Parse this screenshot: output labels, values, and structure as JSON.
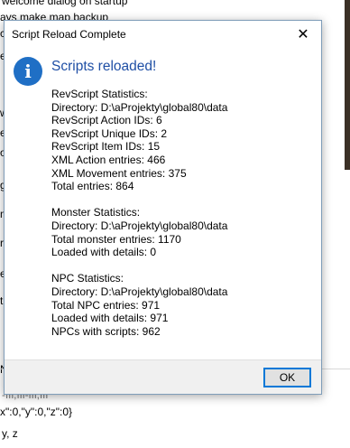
{
  "background": {
    "top_lines": [
      "welcome dialog on startup",
      "ays make map backup"
    ],
    "left_fragments": [
      "c",
      "er",
      "w",
      "e",
      "o",
      "g",
      "m",
      "r",
      "e",
      "t",
      "N"
    ],
    "bottom_lines": [
      "-ffi,ffi-ffi,ffi",
      "x\":0,\"y\":0,\"z\":0}",
      "y, z"
    ]
  },
  "dialog": {
    "title": "Script Reload Complete",
    "close_glyph": "✕",
    "icon": "info-icon",
    "main_instruction": "Scripts reloaded!",
    "content_lines": [
      "RevScript Statistics:",
      "Directory: D:\\aProjekty\\global80\\data",
      "RevScript Action IDs: 6",
      "RevScript Unique IDs: 2",
      "RevScript Item IDs: 15",
      "XML Action entries: 466",
      "XML Movement entries: 375",
      "Total entries: 864",
      "",
      "Monster Statistics:",
      "Directory: D:\\aProjekty\\global80\\data",
      "Total monster entries: 1170",
      "Loaded with details: 0",
      "",
      "NPC Statistics:",
      "Directory: D:\\aProjekty\\global80\\data",
      "Total NPC entries: 971",
      "Loaded with details: 971",
      "NPCs with scripts: 962"
    ],
    "ok_label": "OK"
  },
  "colors": {
    "accent": "#0078d7",
    "instruction_text": "#1f4fa5",
    "icon_fill": "#1f6fc5",
    "footer_bg": "#f0f0f0"
  }
}
